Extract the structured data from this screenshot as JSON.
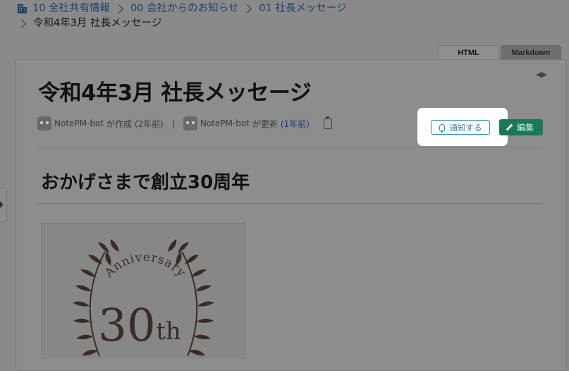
{
  "breadcrumb": {
    "items": [
      "10 全社共有情報",
      "00 会社からのお知らせ",
      "01 社長メッセージ"
    ],
    "current": "令和4年3月 社長メッセージ"
  },
  "tabs": [
    {
      "label": "HTML",
      "active": true
    },
    {
      "label": "Markdown",
      "active": false
    }
  ],
  "page": {
    "title": "令和4年3月 社長メッセージ",
    "meta": {
      "created_by": "NotePM-bot",
      "created_text": "が作成 (2年前)",
      "separator": "|",
      "updated_by": "NotePM-bot",
      "updated_text": "が更新",
      "updated_ago": "(1年前)"
    },
    "notify_label": "通知する",
    "edit_label": "編集",
    "heading": "おかげさまで創立30周年"
  },
  "image": {
    "arc_text": "Anniversary",
    "number": "30",
    "suffix": "th"
  },
  "colors": {
    "link": "#1f3e6e",
    "notify": "#2585b0",
    "edit": "#1a7a54",
    "overlay": "#8a8a8a",
    "emblem": "#3a2c24"
  }
}
